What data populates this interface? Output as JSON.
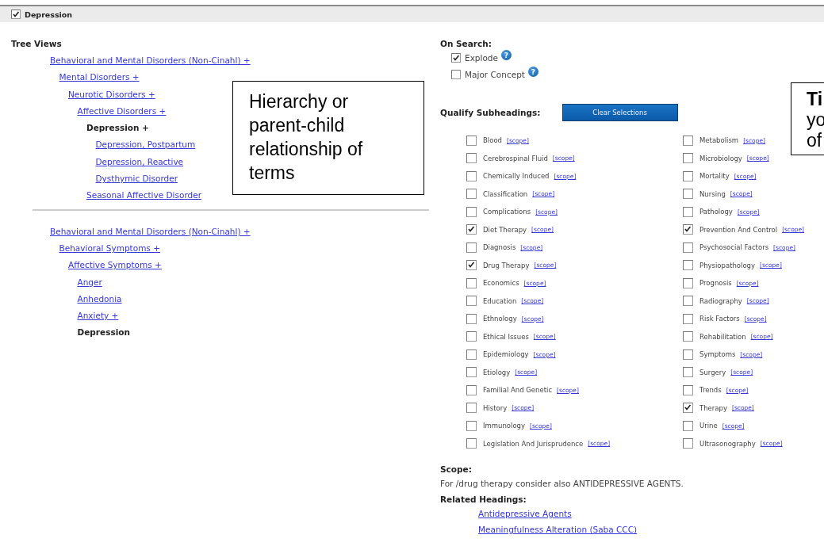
{
  "header": {
    "label": "Depression",
    "checked": true
  },
  "tree_views": {
    "title": "Tree Views",
    "trees": [
      {
        "text": "Behavioral and Mental Disorders (Non-Cinahl) +",
        "kind": "link",
        "children": [
          {
            "text": "Mental Disorders +",
            "kind": "link",
            "children": [
              {
                "text": "Neurotic Disorders +",
                "kind": "link",
                "children": [
                  {
                    "text": "Affective Disorders +",
                    "kind": "link",
                    "children": [
                      {
                        "text": "Depression +",
                        "kind": "current",
                        "children": [
                          {
                            "text": "Depression, Postpartum",
                            "kind": "link"
                          },
                          {
                            "text": "Depression, Reactive",
                            "kind": "link"
                          },
                          {
                            "text": "Dysthymic Disorder",
                            "kind": "link"
                          }
                        ]
                      },
                      {
                        "text": "Seasonal Affective Disorder",
                        "kind": "link"
                      }
                    ]
                  }
                ]
              }
            ]
          }
        ]
      },
      {
        "text": "Behavioral and Mental Disorders (Non-Cinahl) +",
        "kind": "link",
        "children": [
          {
            "text": "Behavioral Symptoms +",
            "kind": "link",
            "children": [
              {
                "text": "Affective Symptoms +",
                "kind": "link",
                "children": [
                  {
                    "text": "Anger",
                    "kind": "link"
                  },
                  {
                    "text": "Anhedonia",
                    "kind": "link"
                  },
                  {
                    "text": "Anxiety +",
                    "kind": "link"
                  },
                  {
                    "text": "Depression",
                    "kind": "current"
                  }
                ]
              }
            ]
          }
        ]
      }
    ]
  },
  "on_search": {
    "title": "On Search:",
    "options": [
      {
        "label": "Explode",
        "checked": true,
        "help": "?"
      },
      {
        "label": "Major Concept",
        "checked": false,
        "help": "?"
      }
    ]
  },
  "subheadings": {
    "title": "Qualify Subheadings:",
    "button": "Clear Selections",
    "columns": [
      [
        {
          "label": "Blood",
          "checked": false,
          "link": "[scope]"
        },
        {
          "label": "Cerebrospinal Fluid",
          "checked": false,
          "link": "[scope]"
        },
        {
          "label": "Chemically Induced",
          "checked": false,
          "link": "[scope]"
        },
        {
          "label": "Classification",
          "checked": false,
          "link": "[scope]"
        },
        {
          "label": "Complications",
          "checked": false,
          "link": "[scope]"
        },
        {
          "label": "Diet Therapy",
          "checked": true,
          "link": "[scope]"
        },
        {
          "label": "Diagnosis",
          "checked": false,
          "link": "[scope]"
        },
        {
          "label": "Drug Therapy",
          "checked": true,
          "link": "[scope]"
        },
        {
          "label": "Economics",
          "checked": false,
          "link": "[scope]"
        },
        {
          "label": "Education",
          "checked": false,
          "link": "[scope]"
        },
        {
          "label": "Ethnology",
          "checked": false,
          "link": "[scope]"
        },
        {
          "label": "Ethical Issues",
          "checked": false,
          "link": "[scope]"
        },
        {
          "label": "Epidemiology",
          "checked": false,
          "link": "[scope]"
        },
        {
          "label": "Etiology",
          "checked": false,
          "link": "[scope]"
        },
        {
          "label": "Familial And Genetic",
          "checked": false,
          "link": "[scope]"
        },
        {
          "label": "History",
          "checked": false,
          "link": "[scope]"
        },
        {
          "label": "Immunology",
          "checked": false,
          "link": "[scope]"
        },
        {
          "label": "Legislation And Jurisprudence",
          "checked": false,
          "link": "[scope]"
        }
      ],
      [
        {
          "label": "Metabolism",
          "checked": false,
          "link": "[scope]"
        },
        {
          "label": "Microbiology",
          "checked": false,
          "link": "[scope]"
        },
        {
          "label": "Mortality",
          "checked": false,
          "link": "[scope]"
        },
        {
          "label": "Nursing",
          "checked": false,
          "link": "[scope]"
        },
        {
          "label": "Pathology",
          "checked": false,
          "link": "[scope]"
        },
        {
          "label": "Prevention And Control",
          "checked": true,
          "link": "[scope]"
        },
        {
          "label": "Psychosocial Factors",
          "checked": false,
          "link": "[scope]"
        },
        {
          "label": "Physiopathology",
          "checked": false,
          "link": "[scope]"
        },
        {
          "label": "Prognosis",
          "checked": false,
          "link": "[scope]"
        },
        {
          "label": "Radiography",
          "checked": false,
          "link": "[scope]"
        },
        {
          "label": "Risk Factors",
          "checked": false,
          "link": "[scope]"
        },
        {
          "label": "Rehabilitation",
          "checked": false,
          "link": "[scope]"
        },
        {
          "label": "Symptoms",
          "checked": false,
          "link": "[scope]"
        },
        {
          "label": "Surgery",
          "checked": false,
          "link": "[scope]"
        },
        {
          "label": "Trends",
          "checked": false,
          "link": "[scope]"
        },
        {
          "label": "Therapy",
          "checked": true,
          "link": "[scope]"
        },
        {
          "label": "Urine",
          "checked": false,
          "link": "[scope]"
        },
        {
          "label": "Ultrasonography",
          "checked": false,
          "link": "[scope]"
        }
      ]
    ]
  },
  "scope": {
    "title": "Scope:",
    "text": "For /drug therapy consider also ANTIDEPRESSIVE AGENTS."
  },
  "related_headings": {
    "title": "Related Headings:",
    "links": [
      "Antidepressive Agents",
      "Meaningfulness Alteration (Saba CCC)"
    ]
  },
  "callouts": [
    {
      "lines": [
        "Hierarchy or",
        "parent-child",
        "relationship of",
        "terms"
      ]
    },
    {
      "title": "Ti",
      "lines": [
        "yo",
        "of"
      ]
    }
  ]
}
